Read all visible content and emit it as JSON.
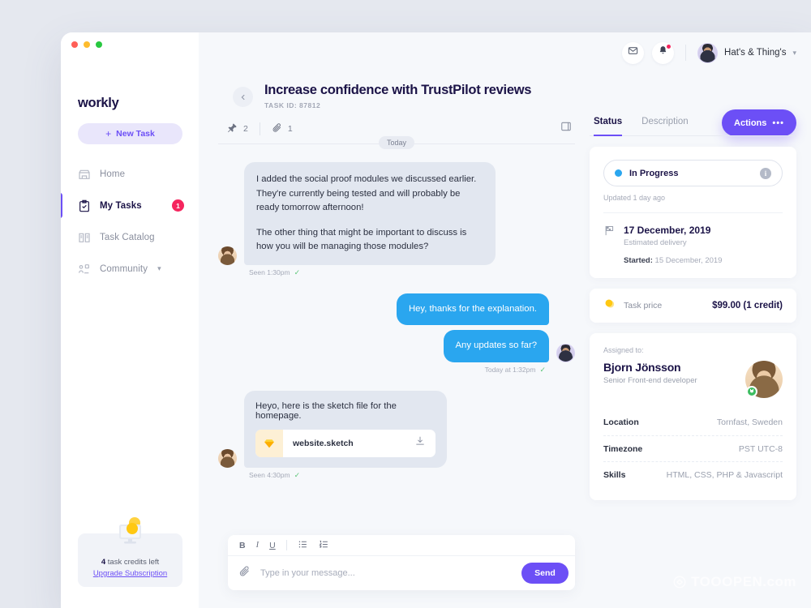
{
  "sidebar": {
    "brand": "workly",
    "new_task_label": "New Task",
    "items": [
      {
        "label": "Home",
        "icon": "home-icon",
        "badge": ""
      },
      {
        "label": "My Tasks",
        "icon": "clipboard-check-icon",
        "badge": "1"
      },
      {
        "label": "Task Catalog",
        "icon": "book-icon",
        "badge": ""
      },
      {
        "label": "Community",
        "icon": "org-chart-icon",
        "badge": ""
      }
    ],
    "credits": {
      "count": "4",
      "text": " task credits left",
      "upgrade_label": "Upgrade Subscription"
    }
  },
  "header": {
    "mail_icon": "envelope-icon",
    "bell_icon": "bell-icon",
    "user_name": "Hat's & Thing's",
    "chevron": "⌄"
  },
  "task": {
    "back_icon": "chevron-left-icon",
    "title": "Increase confidence with TrustPilot reviews",
    "task_id": "TASK ID: 87812",
    "actions_label": "Actions",
    "actions_dots": "•••",
    "pins_count": "2",
    "attachments_count": "1",
    "day_divider": "Today"
  },
  "messages": [
    {
      "side": "in",
      "paragraphs": [
        "I added the social proof modules we discussed earlier. They're currently being tested and will probably be ready tomorrow afternoon!",
        "The other thing that might be important to discuss is how you will be managing those modules?"
      ],
      "status": "Seen 1:30pm"
    },
    {
      "side": "out",
      "text": "Hey, thanks for the explanation."
    },
    {
      "side": "out",
      "text": "Any updates so far?",
      "status": "Today at 1:32pm"
    },
    {
      "side": "in",
      "text": "Heyo, here is the sketch file for the homepage.",
      "file_name": "website.sketch",
      "file_icon": "sketch-gem-icon",
      "download_icon": "download-icon",
      "status": "Seen 4:30pm"
    }
  ],
  "composer": {
    "bold": "B",
    "italic": "I",
    "underline": "U",
    "bullet_list_icon": "bullet-list-icon",
    "numbered_list_icon": "numbered-list-icon",
    "attach_icon": "paperclip-icon",
    "placeholder": "Type in your message...",
    "send_label": "Send"
  },
  "panel": {
    "tabs": [
      {
        "label": "Status",
        "active": true
      },
      {
        "label": "Description",
        "active": false
      }
    ],
    "status": {
      "value": "In Progress",
      "dot_color": "#2aa6ef",
      "info_icon": "info-icon",
      "updated": "Updated 1 day ago"
    },
    "delivery": {
      "flag_icon": "checkered-flag-icon",
      "date": "17 December, 2019",
      "caption": "Estimated delivery",
      "started_label": "Started:",
      "started_value": " 15 December, 2019"
    },
    "price": {
      "coin_icon": "coin-icon",
      "label": "Task price",
      "value": "$99.00 (1 credit)"
    },
    "assignee": {
      "assigned_label": "Assigned to:",
      "name": "Bjorn Jönsson",
      "role": "Senior Front-end developer",
      "online_icon": "online-badge-icon",
      "rows": [
        {
          "key": "Location",
          "value": "Tornfast, Sweden"
        },
        {
          "key": "Timezone",
          "value": "PST UTC-8"
        },
        {
          "key": "Skills",
          "value": "HTML, CSS, PHP & Javascript"
        }
      ]
    }
  },
  "watermark": "TOOOPEN.com",
  "colors": {
    "accent": "#6c4ff6",
    "blue": "#2aa6ef",
    "badge_red": "#f5255e",
    "page_bg": "#e5e8ef"
  }
}
